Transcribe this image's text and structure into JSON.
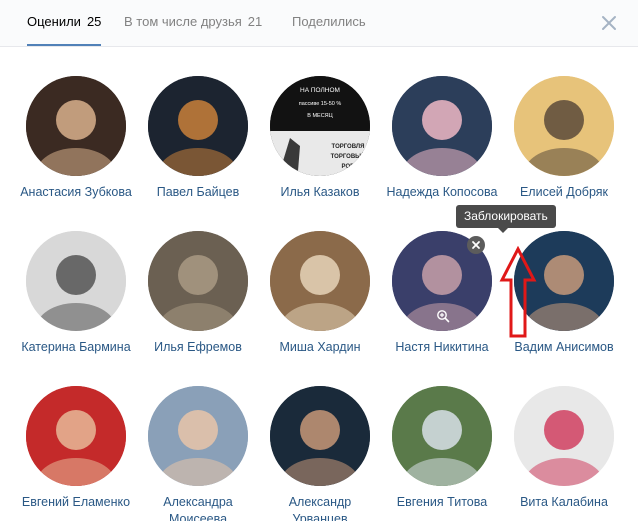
{
  "tabs": [
    {
      "label": "Оценили",
      "count": "25"
    },
    {
      "label": "В том числе друзья",
      "count": "21"
    },
    {
      "label": "Поделились",
      "count": ""
    }
  ],
  "tooltip": "Заблокировать",
  "people": [
    {
      "name": "Анастасия Зубкова",
      "colors": [
        "#3b2a22",
        "#d9b08c"
      ]
    },
    {
      "name": "Павел Байцев",
      "colors": [
        "#1c2430",
        "#c9803a"
      ]
    },
    {
      "name": "Илья Казаков",
      "colors": [
        "#1a1a1a",
        "#e0e0e0"
      ],
      "ad": [
        "НА ПОЛНОМ",
        "пассиве 15-50 %",
        "В МЕСЯЦ"
      ],
      "ad_bottom": [
        "ТОРГОВЛЯ",
        "ТОРГОВЫЙ",
        "РОБ"
      ]
    },
    {
      "name": "Надежда Копосова",
      "colors": [
        "#2c3e5a",
        "#f0b8c6"
      ]
    },
    {
      "name": "Елисей Добряк",
      "colors": [
        "#e7c37a",
        "#5a4a3a"
      ]
    },
    {
      "name": "Катерина Бармина",
      "colors": [
        "#d8d8d8",
        "#555555"
      ]
    },
    {
      "name": "Илья Ефремов",
      "colors": [
        "#6b6052",
        "#a99a84"
      ]
    },
    {
      "name": "Миша Хардин",
      "colors": [
        "#8b6a4a",
        "#e6d3b8"
      ]
    },
    {
      "name": "Настя Никитина",
      "colors": [
        "#3a3f6a",
        "#c8a0a8"
      ]
    },
    {
      "name": "Вадим Анисимов",
      "colors": [
        "#1d3b5a",
        "#c79a7a"
      ]
    },
    {
      "name": "Евгений Еламенко",
      "colors": [
        "#c42a2a",
        "#e8b898"
      ]
    },
    {
      "name": "Александра Моисеева",
      "colors": [
        "#8aa0b8",
        "#e7c4a8"
      ]
    },
    {
      "name": "Александр Урванцев",
      "colors": [
        "#1a2a3a",
        "#c89878"
      ]
    },
    {
      "name": "Евгения Титова",
      "colors": [
        "#5a7a4a",
        "#d8e0e8"
      ]
    },
    {
      "name": "Вита Калабина",
      "colors": [
        "#e8e8e8",
        "#d04060"
      ]
    }
  ]
}
